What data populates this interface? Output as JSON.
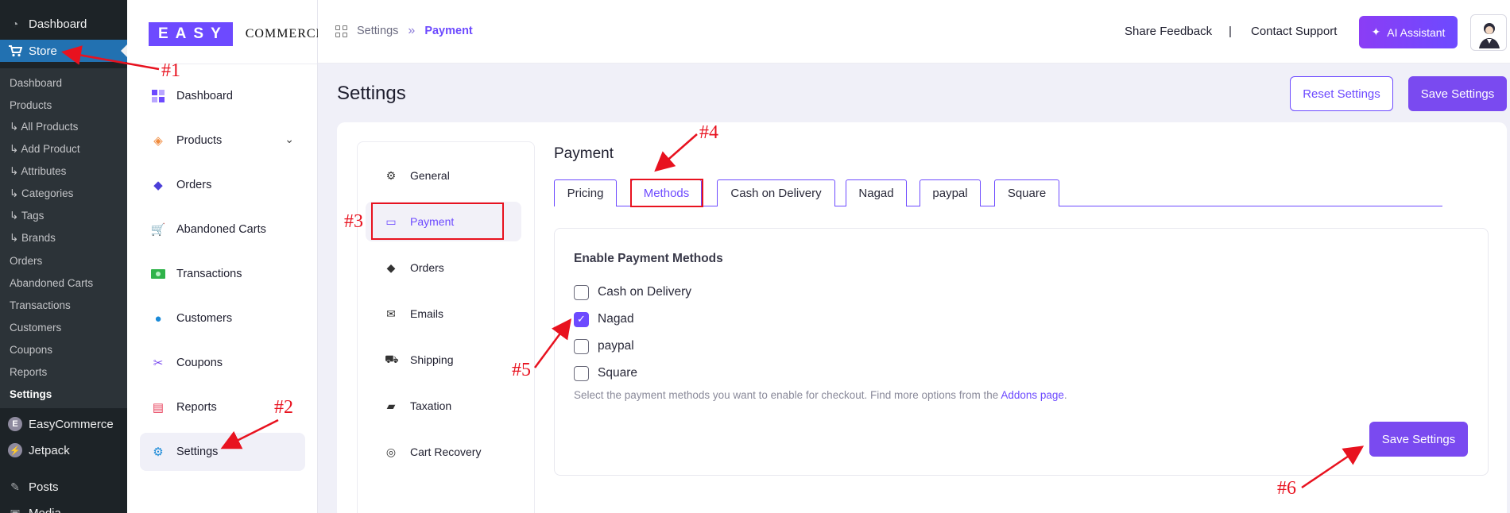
{
  "wp_sidebar": {
    "top_items": [
      {
        "label": "Dashboard",
        "icon": "dashboard-icon"
      },
      {
        "label": "Store",
        "icon": "cart-icon"
      }
    ],
    "submenu": [
      {
        "label": "Dashboard"
      },
      {
        "label": "Products"
      },
      {
        "label": "↳ All Products"
      },
      {
        "label": "↳ Add Product"
      },
      {
        "label": "↳ Attributes"
      },
      {
        "label": "↳ Categories"
      },
      {
        "label": "↳ Tags"
      },
      {
        "label": "↳ Brands"
      },
      {
        "label": "Orders"
      },
      {
        "label": "Abandoned Carts"
      },
      {
        "label": "Transactions"
      },
      {
        "label": "Customers"
      },
      {
        "label": "Coupons"
      },
      {
        "label": "Reports"
      },
      {
        "label": "Settings"
      }
    ],
    "bottom_items": [
      {
        "label": "EasyCommerce",
        "icon": "easycommerce-icon"
      },
      {
        "label": "Jetpack",
        "icon": "jetpack-icon"
      },
      {
        "label": "Posts",
        "icon": "pin-icon"
      },
      {
        "label": "Media",
        "icon": "media-icon"
      }
    ]
  },
  "logo": {
    "part1": "EASY",
    "part2": "COMMERCE"
  },
  "ec_sidebar": {
    "items": [
      {
        "label": "Dashboard",
        "icon": "dashboard-icon"
      },
      {
        "label": "Products",
        "icon": "box-icon"
      },
      {
        "label": "Orders",
        "icon": "bag-icon"
      },
      {
        "label": "Abandoned Carts",
        "icon": "cart-icon"
      },
      {
        "label": "Transactions",
        "icon": "money-icon"
      },
      {
        "label": "Customers",
        "icon": "users-icon"
      },
      {
        "label": "Coupons",
        "icon": "ticket-icon"
      },
      {
        "label": "Reports",
        "icon": "report-icon"
      },
      {
        "label": "Settings",
        "icon": "gear-icon"
      }
    ]
  },
  "header": {
    "breadcrumb": {
      "root": "Settings",
      "current": "Payment"
    },
    "share_feedback": "Share Feedback",
    "separator": "|",
    "contact_support": "Contact Support",
    "ai_assistant": "AI Assistant"
  },
  "page": {
    "title": "Settings",
    "reset_button": "Reset Settings",
    "save_button": "Save Settings"
  },
  "settings_nav": {
    "items": [
      {
        "label": "General",
        "icon": "gear-icon"
      },
      {
        "label": "Payment",
        "icon": "card-icon"
      },
      {
        "label": "Orders",
        "icon": "bag-icon"
      },
      {
        "label": "Emails",
        "icon": "mail-icon"
      },
      {
        "label": "Shipping",
        "icon": "shipping-icon"
      },
      {
        "label": "Taxation",
        "icon": "tax-icon"
      },
      {
        "label": "Cart Recovery",
        "icon": "recovery-icon"
      }
    ],
    "active": "Payment"
  },
  "payment": {
    "title": "Payment",
    "tabs": [
      "Pricing",
      "Methods",
      "Cash on Delivery",
      "Nagad",
      "paypal",
      "Square"
    ],
    "active_tab": "Methods",
    "methods_heading": "Enable Payment Methods",
    "methods": [
      {
        "label": "Cash on Delivery",
        "checked": false
      },
      {
        "label": "Nagad",
        "checked": true
      },
      {
        "label": "paypal",
        "checked": false
      },
      {
        "label": "Square",
        "checked": false
      }
    ],
    "help_text": "Select the payment methods you want to enable for checkout. Find more options from the ",
    "help_link": "Addons page",
    "help_end": ".",
    "save_button": "Save Settings"
  },
  "annotations": [
    "#1",
    "#2",
    "#3",
    "#4",
    "#5",
    "#6"
  ],
  "colors": {
    "accent": "#6d4aff",
    "annotation": "#e8121f",
    "wp_sidebar": "#1d2327",
    "wp_active": "#2271b1"
  }
}
